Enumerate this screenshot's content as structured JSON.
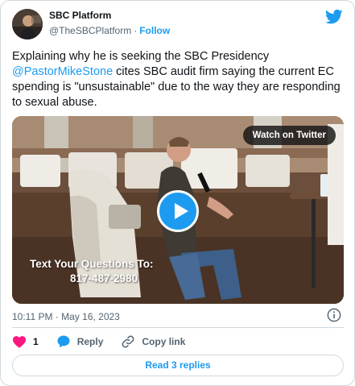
{
  "author": {
    "name": "SBC Platform",
    "handle": "@TheSBCPlatform",
    "separator": "·",
    "follow_label": "Follow",
    "avatar_icon": "profile-photo",
    "brand_icon": "twitter-bird-icon",
    "brand_color": "#1d9bf0"
  },
  "tweet": {
    "text_before": "Explaining why he is seeking the SBC Presidency ",
    "mention": "@PastorMikeStone",
    "text_after": " cites SBC audit firm saying the current EC spending is \"unsustainable\" due to the way they are responding to sexual abuse."
  },
  "media": {
    "watch_label": "Watch on Twitter",
    "overlay_line1": "Text Your Questions To:",
    "overlay_line2": "817-487-2980",
    "play_icon": "play-icon"
  },
  "meta": {
    "timestamp": "10:11 PM · May 16, 2023",
    "info_icon": "info-icon"
  },
  "actions": {
    "like_count": "1",
    "reply_label": "Reply",
    "copy_label": "Copy link",
    "like_icon": "heart-icon",
    "reply_icon": "reply-bubble-icon",
    "copy_icon": "link-icon",
    "like_color": "#f91880"
  },
  "footer": {
    "read_replies_label": "Read 3 replies"
  }
}
